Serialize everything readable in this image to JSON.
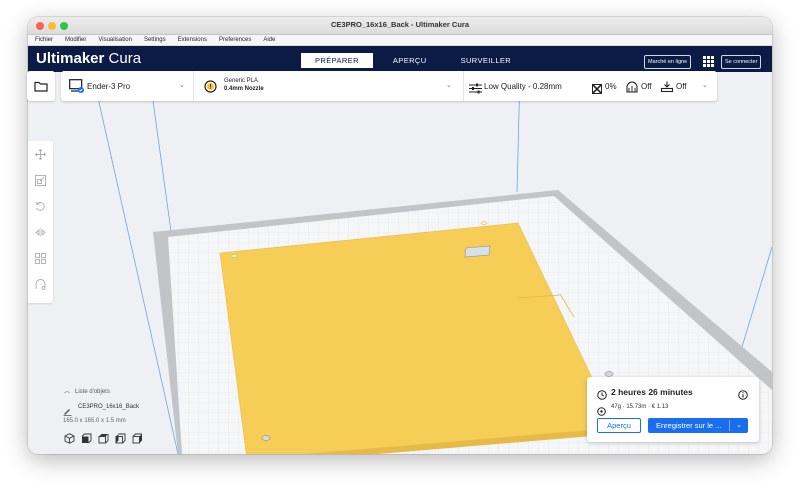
{
  "window": {
    "title": "CE3PRO_16x16_Back - Ultimaker Cura"
  },
  "menu": [
    "Fichier",
    "Modifier",
    "Visualisation",
    "Settings",
    "Extensions",
    "Preferences",
    "Aide"
  ],
  "brand": {
    "bold": "Ultimaker",
    "light": "Cura"
  },
  "stages": [
    "PRÉPARER",
    "APERÇU",
    "SURVEILLER"
  ],
  "active_stage": "PRÉPARER",
  "header": {
    "marketplace": "Marché en ligne",
    "signin": "Se connecter"
  },
  "printer": {
    "name": "Ender-3 Pro"
  },
  "material": {
    "name": "Generic PLA",
    "nozzle": "0.4mm Nozzle"
  },
  "print_settings": {
    "quality": "Low Quality - 0.28mm",
    "infill": "0%",
    "support": "Off",
    "adhesion": "Off"
  },
  "tools": [
    "move-icon",
    "scale-icon",
    "rotate-icon",
    "mirror-icon",
    "per-model-settings-icon",
    "support-blocker-icon"
  ],
  "object_list": {
    "header": "Liste d'objets",
    "object_name": "CE3PRO_16x16_Back",
    "dimensions": "165.0 x 165.0 x 1.5 mm"
  },
  "view_buttons": [
    "view-3d-icon",
    "view-front-icon",
    "view-top-icon",
    "view-left-icon",
    "view-right-icon"
  ],
  "estimate": {
    "time": "2 heures 26 minutes",
    "material": "47g · 15.73m · € 1.13",
    "preview_label": "Aperçu",
    "save_label": "Enregistrer sur le ..."
  },
  "colors": {
    "header_bg": "#0b1b46",
    "accent_blue": "#196ef0",
    "model_yellow": "#f6cd57",
    "build_plate": "#f5f6f8",
    "plate_border": "#b8babd"
  }
}
